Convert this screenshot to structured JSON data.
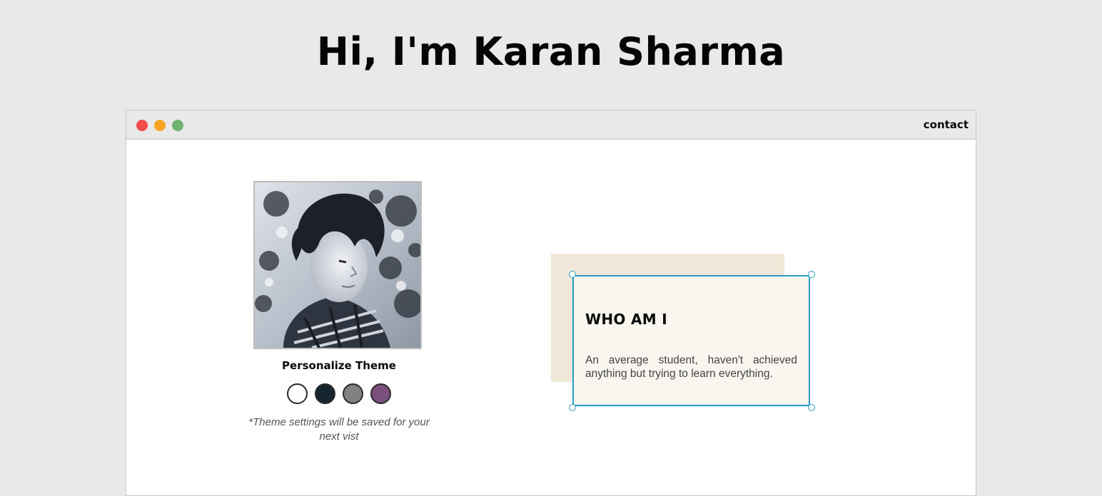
{
  "page": {
    "title": "Hi, I'm Karan Sharma"
  },
  "window": {
    "controls": [
      {
        "name": "close",
        "color": "#f24b4b"
      },
      {
        "name": "minimize",
        "color": "#f6a623"
      },
      {
        "name": "zoom",
        "color": "#6db36f"
      }
    ],
    "nav_link": "contact"
  },
  "profile": {
    "photo_icon": "profile-photo",
    "theme_heading": "Personalize Theme",
    "theme_swatches": [
      {
        "name": "light",
        "color": "#ffffff"
      },
      {
        "name": "dark-blue",
        "color": "#17252e"
      },
      {
        "name": "grey",
        "color": "#808080"
      },
      {
        "name": "purple",
        "color": "#7a4f7e"
      }
    ],
    "theme_note": "*Theme settings will be saved for your next vist"
  },
  "about": {
    "heading": "WHO AM I",
    "body": "An average student, haven't achieved anything but trying to learn everything."
  },
  "colors": {
    "page_background": "#e9e9e9",
    "accent_border": "#2a9bc4",
    "card_back": "#efe8d8",
    "card_front": "#f8f6ee"
  }
}
